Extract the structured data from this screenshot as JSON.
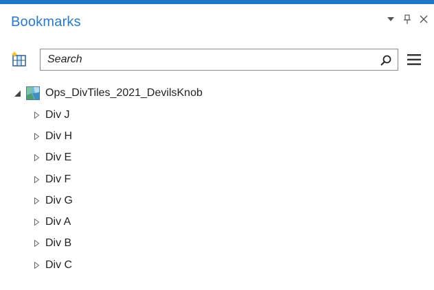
{
  "pane": {
    "title": "Bookmarks",
    "accent_color": "#1e78c8",
    "title_color": "#2a7ac6",
    "controls": {
      "dropdown_icon": "chevron-down-icon",
      "pin_icon": "pin-icon",
      "close_icon": "close-icon"
    }
  },
  "toolbar": {
    "new_bookmark_icon": "new-bookmark-icon",
    "search": {
      "placeholder": "Search",
      "value": ""
    },
    "search_icon": "search-icon",
    "menu_icon": "hamburger-menu-icon"
  },
  "tree": {
    "root": {
      "label": "Ops_DivTiles_2021_DevilsKnob",
      "expanded": true,
      "icon": "map-icon"
    },
    "items": [
      {
        "label": "Div J"
      },
      {
        "label": "Div H"
      },
      {
        "label": "Div E"
      },
      {
        "label": "Div F"
      },
      {
        "label": "Div G"
      },
      {
        "label": "Div A"
      },
      {
        "label": "Div B"
      },
      {
        "label": "Div C"
      }
    ]
  }
}
